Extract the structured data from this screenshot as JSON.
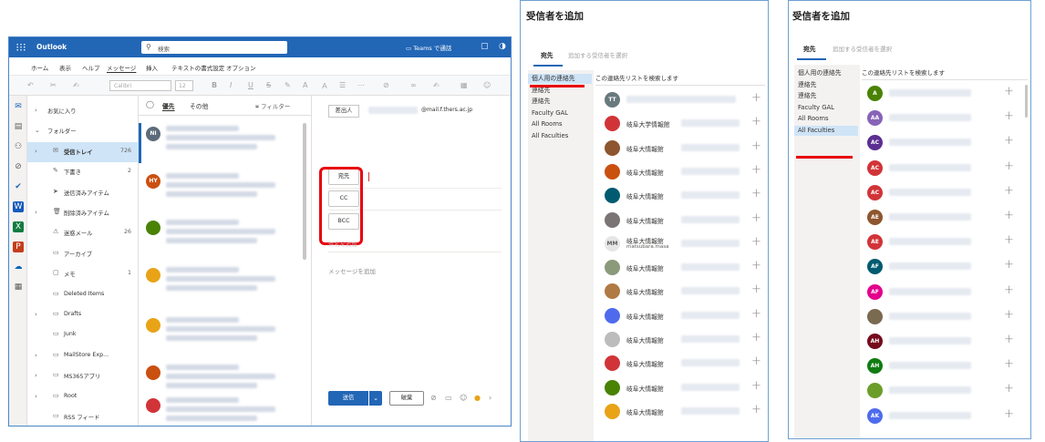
{
  "outlook": {
    "app_title": "Outlook",
    "search_placeholder": "検索",
    "teams_call": "Teams で通話",
    "menu": [
      "ホーム",
      "表示",
      "ヘルプ",
      "メッセージ",
      "挿入",
      "テキストの書式設定",
      "オプション"
    ],
    "active_menu": "メッセージ",
    "font_name": "Calibri",
    "font_size": "12",
    "folders": [
      {
        "label": "お気に入り",
        "count": "",
        "chev": "›",
        "icon": ""
      },
      {
        "label": "フォルダー",
        "count": "",
        "chev": "⌄",
        "icon": ""
      },
      {
        "label": "受信トレイ",
        "count": "726",
        "chev": "›",
        "icon": "✉"
      },
      {
        "label": "下書き",
        "count": "2",
        "chev": "",
        "icon": "✎"
      },
      {
        "label": "送信済みアイテム",
        "count": "",
        "chev": "",
        "icon": "➤"
      },
      {
        "label": "削除済みアイテム",
        "count": "",
        "chev": "›",
        "icon": "🗑"
      },
      {
        "label": "迷惑メール",
        "count": "26",
        "chev": "",
        "icon": "⚠"
      },
      {
        "label": "アーカイブ",
        "count": "",
        "chev": "",
        "icon": "▭"
      },
      {
        "label": "メモ",
        "count": "1",
        "chev": "",
        "icon": "▢"
      },
      {
        "label": "Deleted Items",
        "count": "",
        "chev": "",
        "icon": "▭"
      },
      {
        "label": "Drafts",
        "count": "",
        "chev": "›",
        "icon": "▭"
      },
      {
        "label": "Junk",
        "count": "",
        "chev": "",
        "icon": "▭"
      },
      {
        "label": "MailStore Exp...",
        "count": "",
        "chev": "›",
        "icon": "▭"
      },
      {
        "label": "MS365アプリ",
        "count": "",
        "chev": "›",
        "icon": "▭"
      },
      {
        "label": "Root",
        "count": "",
        "chev": "›",
        "icon": "▭"
      },
      {
        "label": "RSS フィード",
        "count": "",
        "chev": "",
        "icon": "▭"
      }
    ],
    "list_tabs": {
      "focused": "優先",
      "other": "その他",
      "filter": "フィルター"
    },
    "messages": [
      {
        "initials": "NI",
        "color": "#5c6b7a"
      },
      {
        "initials": "HY",
        "color": "#ca5010"
      },
      {
        "initials": "",
        "color": "#498205"
      },
      {
        "initials": "",
        "color": "#e8a317"
      },
      {
        "initials": "",
        "color": "#e8a317"
      },
      {
        "initials": "",
        "color": "#ca5010"
      },
      {
        "initials": "",
        "color": "#d13438"
      }
    ],
    "compose": {
      "from_label": "差出人",
      "from_email": "@mail.f.thers.ac.jp",
      "to_label": "宛先",
      "cc_label": "CC",
      "bcc_label": "BCC",
      "subject_placeholder": "件名を追加",
      "body_placeholder": "メッセージを追加",
      "send_label": "送信",
      "discard_label": "破棄"
    }
  },
  "picker_left": {
    "title": "受信者を追加",
    "tab": "宛先",
    "placeholder": "追加する受信者を選択",
    "categories": [
      "個人用の連絡先",
      "連絡先",
      "連絡先",
      "Faculty GAL",
      "All Rooms",
      "All Faculties"
    ],
    "selected_category": "個人用の連絡先",
    "search_placeholder": "この連絡先リストを検索します",
    "contacts": [
      {
        "initials": "TT",
        "color": "#69797e",
        "name": "",
        "sub": ""
      },
      {
        "initials": "",
        "color": "#d13438",
        "name": "岐阜大学情報館",
        "sub": ""
      },
      {
        "initials": "",
        "color": "#8e562e",
        "name": "岐阜大情報館",
        "sub": ""
      },
      {
        "initials": "",
        "color": "#ca5010",
        "name": "岐阜大情報館",
        "sub": ""
      },
      {
        "initials": "",
        "color": "#005b70",
        "name": "岐阜大情報館",
        "sub": ""
      },
      {
        "initials": "",
        "color": "#7a7574",
        "name": "岐阜大情報館",
        "sub": ""
      },
      {
        "initials": "MM",
        "color": "#e6e6e6",
        "name": "岐阜大情報館",
        "sub": "matsubara.masa"
      },
      {
        "initials": "",
        "color": "#8a9a7b",
        "name": "岐阜大情報館",
        "sub": ""
      },
      {
        "initials": "",
        "color": "#b07a44",
        "name": "岐阜大情報館",
        "sub": ""
      },
      {
        "initials": "",
        "color": "#4f6bed",
        "name": "岐阜大情報館",
        "sub": ""
      },
      {
        "initials": "",
        "color": "#bcbcbc",
        "name": "岐阜大情報館",
        "sub": ""
      },
      {
        "initials": "",
        "color": "#d13438",
        "name": "岐阜大情報館",
        "sub": ""
      },
      {
        "initials": "",
        "color": "#498205",
        "name": "岐阜大情報館",
        "sub": ""
      },
      {
        "initials": "",
        "color": "#e8a317",
        "name": "岐阜大情報館",
        "sub": ""
      }
    ]
  },
  "picker_right": {
    "title": "受信者を追加",
    "tab": "宛先",
    "placeholder": "追加する受信者を選択",
    "categories": [
      "個人用の連絡先",
      "連絡先",
      "連絡先",
      "Faculty GAL",
      "All Rooms",
      "All Faculties"
    ],
    "selected_category": "All Faculties",
    "search_placeholder": "この連絡先リストを検索します",
    "contacts": [
      {
        "initials": "A",
        "color": "#498205"
      },
      {
        "initials": "AA",
        "color": "#8764b8"
      },
      {
        "initials": "AC",
        "color": "#5c2e91"
      },
      {
        "initials": "AC",
        "color": "#d13438"
      },
      {
        "initials": "AC",
        "color": "#d13438"
      },
      {
        "initials": "AE",
        "color": "#8e562e"
      },
      {
        "initials": "AE",
        "color": "#d13438"
      },
      {
        "initials": "AF",
        "color": "#005b70"
      },
      {
        "initials": "AF",
        "color": "#e3008c"
      },
      {
        "initials": "",
        "color": "#7a6a4f"
      },
      {
        "initials": "AH",
        "color": "#750b1c"
      },
      {
        "initials": "AH",
        "color": "#107c10"
      },
      {
        "initials": "",
        "color": "#6b9d2a"
      },
      {
        "initials": "AK",
        "color": "#4f6bed"
      }
    ]
  },
  "icons": [
    "waffle-icon",
    "search-icon",
    "teams-icon",
    "mail-icon",
    "calendar-icon",
    "people-icon",
    "plus-icon",
    "chevron-right-icon"
  ]
}
